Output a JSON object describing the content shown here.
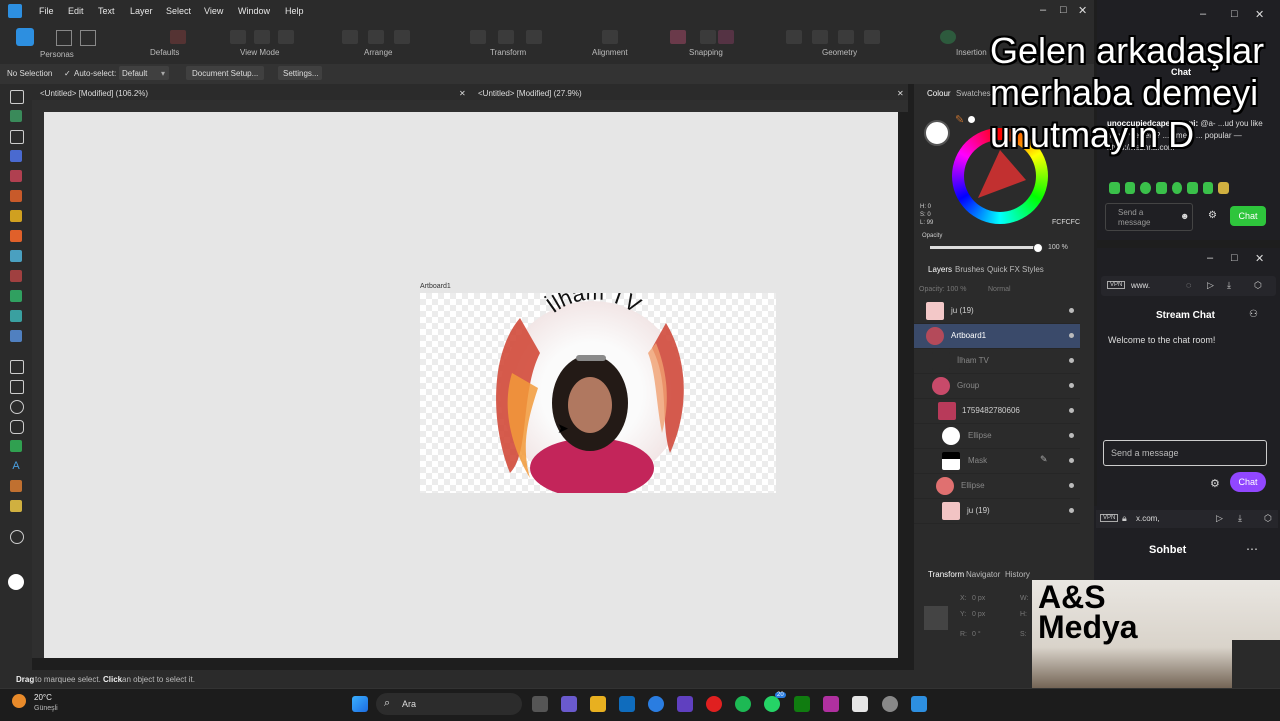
{
  "menubar": {
    "items": [
      "File",
      "Edit",
      "Text",
      "Layer",
      "Select",
      "View",
      "Window",
      "Help"
    ]
  },
  "toolbar": {
    "groups": [
      "Personas",
      "Defaults",
      "View Mode",
      "Arrange",
      "Transform",
      "Alignment",
      "Snapping",
      "Geometry",
      "Insertion"
    ]
  },
  "context": {
    "selection": "No Selection",
    "autoselect_label": "Auto-select:",
    "autoselect_value": "Default",
    "document_setup": "Document Setup...",
    "settings": "Settings..."
  },
  "tabs": [
    "<Untitled> [Modified] (106.2%)",
    "<Untitled> [Modified] (27.9%)"
  ],
  "artboard": {
    "label": "Artboard1",
    "title_text": "İlham TV"
  },
  "status": {
    "drag": "Drag",
    "text1": " to marquee select. ",
    "click": "Click",
    "text2": " an object to select it."
  },
  "colour_panel": {
    "tabs": [
      "Colour",
      "Swatches"
    ],
    "hex": "FCFCFC",
    "hsl": [
      "H: 0",
      "S: 0",
      "L: 99"
    ],
    "opacity_label": "Opacity",
    "opacity_value": "100 %"
  },
  "layers_panel": {
    "tabs": [
      "Layers",
      "Brushes",
      "Quick FX",
      "Styles"
    ],
    "opacity": "Opacity: 100 %",
    "blend": "Normal",
    "rows": [
      {
        "name": "ju (19)"
      },
      {
        "name": "Artboard1"
      },
      {
        "name": "İlham TV"
      },
      {
        "name": "Group"
      },
      {
        "name": "1759482780606"
      },
      {
        "name": "Ellipse"
      },
      {
        "name": "Mask"
      },
      {
        "name": "Ellipse"
      },
      {
        "name": "ju (19)"
      }
    ]
  },
  "transform_panel": {
    "tabs": [
      "Transform",
      "Navigator",
      "History"
    ],
    "x": "0 px",
    "y": "0 px",
    "r": "0 °",
    "w_label": "W:",
    "h_label": "H:",
    "s_label": "S:",
    "x_label": "X:",
    "y_label": "Y:",
    "r_label": "R:"
  },
  "chat1": {
    "header": "Chat",
    "user": "unoccupiedcaperzkieni:",
    "message": " @a- ...ud you like many viewers? ...e me... ... popular — https://nezhna.com",
    "input_placeholder": "Send a message",
    "button": "Chat"
  },
  "chat2": {
    "url": "www.",
    "title": "Stream Chat",
    "welcome": "Welcome to the chat room!",
    "input_placeholder": "Send a message",
    "button": "Chat"
  },
  "chat3": {
    "url": "x.com,",
    "title": "Sohbet"
  },
  "overlay": {
    "text": "Gelen arkadaşlar merhaba demeyi unutmayın D"
  },
  "webcam": {
    "brand": "A&S Medya"
  },
  "taskbar": {
    "temp": "20°C",
    "weather": "Güneşli",
    "search": "Ara",
    "badge": "20"
  }
}
